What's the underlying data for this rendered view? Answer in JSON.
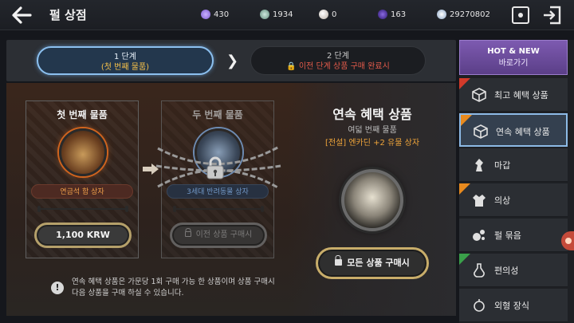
{
  "header": {
    "title": "펄 상점",
    "currencies": [
      {
        "value": "430",
        "color": "#9b7be0"
      },
      {
        "value": "1934",
        "color": "#8fb8a8"
      },
      {
        "value": "0",
        "color": "#d8d0c8"
      },
      {
        "value": "163",
        "color": "#5a3fb0"
      },
      {
        "value": "29270802",
        "color": "#bfd3ea"
      }
    ]
  },
  "stages": {
    "stage1": {
      "title": "1 단계",
      "subtitle": "(첫 번째 물품)"
    },
    "stage2": {
      "title": "2 단계",
      "subtitle": "이전 단계 상품 구매 완료시"
    }
  },
  "cards": {
    "card1": {
      "title": "첫 번째 물품",
      "item_name": "연금석 함 상자",
      "price": "1,100 KRW"
    },
    "card2": {
      "title": "두 번째 물품",
      "item_name": "3세대 반려동물 상자",
      "button": "이전 상품 구매시"
    }
  },
  "showcase": {
    "title": "연속 혜택 상품",
    "subtitle": "여덟 번째 물품",
    "item": "[전설] 엔카딘 +2 유물 상자",
    "buy_all": "모든 상품 구매시"
  },
  "notice": "연속 혜택 상품은 가문당 1회 구매 가능 한 상품이며 상품 구매시 다음 상품을 구매 하실 수 있습니다.",
  "sidebar": {
    "hotnew_title": "HOT & NEW",
    "hotnew_sub": "바로가기",
    "items": [
      {
        "label": "최고 혜택 상품",
        "badge": "red"
      },
      {
        "label": "연속 혜택 상품",
        "badge": "orange"
      },
      {
        "label": "마갑",
        "badge": ""
      },
      {
        "label": "의상",
        "badge": "orange"
      },
      {
        "label": "펄 묶음",
        "badge": ""
      },
      {
        "label": "편의성",
        "badge": "green"
      },
      {
        "label": "외형 장식",
        "badge": ""
      }
    ]
  }
}
